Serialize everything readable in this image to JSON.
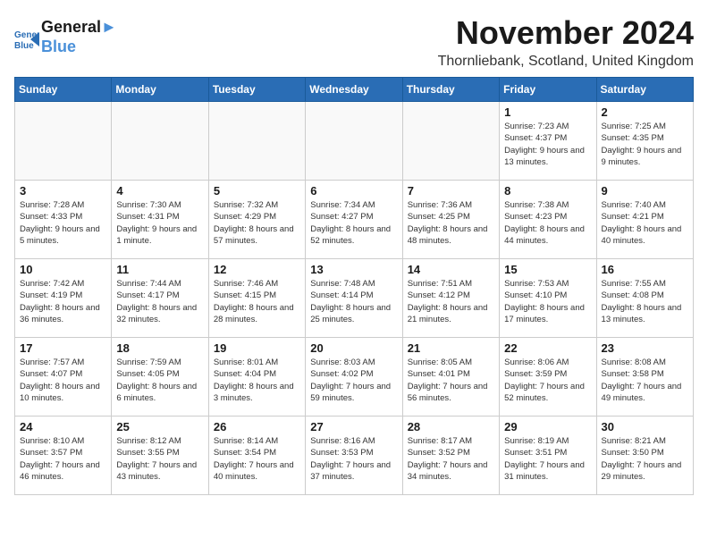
{
  "header": {
    "logo_line1": "General",
    "logo_line2": "Blue",
    "month_title": "November 2024",
    "location": "Thornliebank, Scotland, United Kingdom"
  },
  "weekdays": [
    "Sunday",
    "Monday",
    "Tuesday",
    "Wednesday",
    "Thursday",
    "Friday",
    "Saturday"
  ],
  "weeks": [
    [
      {
        "day": "",
        "sunrise": "",
        "sunset": "",
        "daylight": ""
      },
      {
        "day": "",
        "sunrise": "",
        "sunset": "",
        "daylight": ""
      },
      {
        "day": "",
        "sunrise": "",
        "sunset": "",
        "daylight": ""
      },
      {
        "day": "",
        "sunrise": "",
        "sunset": "",
        "daylight": ""
      },
      {
        "day": "",
        "sunrise": "",
        "sunset": "",
        "daylight": ""
      },
      {
        "day": "1",
        "sunrise": "Sunrise: 7:23 AM",
        "sunset": "Sunset: 4:37 PM",
        "daylight": "Daylight: 9 hours and 13 minutes."
      },
      {
        "day": "2",
        "sunrise": "Sunrise: 7:25 AM",
        "sunset": "Sunset: 4:35 PM",
        "daylight": "Daylight: 9 hours and 9 minutes."
      }
    ],
    [
      {
        "day": "3",
        "sunrise": "Sunrise: 7:28 AM",
        "sunset": "Sunset: 4:33 PM",
        "daylight": "Daylight: 9 hours and 5 minutes."
      },
      {
        "day": "4",
        "sunrise": "Sunrise: 7:30 AM",
        "sunset": "Sunset: 4:31 PM",
        "daylight": "Daylight: 9 hours and 1 minute."
      },
      {
        "day": "5",
        "sunrise": "Sunrise: 7:32 AM",
        "sunset": "Sunset: 4:29 PM",
        "daylight": "Daylight: 8 hours and 57 minutes."
      },
      {
        "day": "6",
        "sunrise": "Sunrise: 7:34 AM",
        "sunset": "Sunset: 4:27 PM",
        "daylight": "Daylight: 8 hours and 52 minutes."
      },
      {
        "day": "7",
        "sunrise": "Sunrise: 7:36 AM",
        "sunset": "Sunset: 4:25 PM",
        "daylight": "Daylight: 8 hours and 48 minutes."
      },
      {
        "day": "8",
        "sunrise": "Sunrise: 7:38 AM",
        "sunset": "Sunset: 4:23 PM",
        "daylight": "Daylight: 8 hours and 44 minutes."
      },
      {
        "day": "9",
        "sunrise": "Sunrise: 7:40 AM",
        "sunset": "Sunset: 4:21 PM",
        "daylight": "Daylight: 8 hours and 40 minutes."
      }
    ],
    [
      {
        "day": "10",
        "sunrise": "Sunrise: 7:42 AM",
        "sunset": "Sunset: 4:19 PM",
        "daylight": "Daylight: 8 hours and 36 minutes."
      },
      {
        "day": "11",
        "sunrise": "Sunrise: 7:44 AM",
        "sunset": "Sunset: 4:17 PM",
        "daylight": "Daylight: 8 hours and 32 minutes."
      },
      {
        "day": "12",
        "sunrise": "Sunrise: 7:46 AM",
        "sunset": "Sunset: 4:15 PM",
        "daylight": "Daylight: 8 hours and 28 minutes."
      },
      {
        "day": "13",
        "sunrise": "Sunrise: 7:48 AM",
        "sunset": "Sunset: 4:14 PM",
        "daylight": "Daylight: 8 hours and 25 minutes."
      },
      {
        "day": "14",
        "sunrise": "Sunrise: 7:51 AM",
        "sunset": "Sunset: 4:12 PM",
        "daylight": "Daylight: 8 hours and 21 minutes."
      },
      {
        "day": "15",
        "sunrise": "Sunrise: 7:53 AM",
        "sunset": "Sunset: 4:10 PM",
        "daylight": "Daylight: 8 hours and 17 minutes."
      },
      {
        "day": "16",
        "sunrise": "Sunrise: 7:55 AM",
        "sunset": "Sunset: 4:08 PM",
        "daylight": "Daylight: 8 hours and 13 minutes."
      }
    ],
    [
      {
        "day": "17",
        "sunrise": "Sunrise: 7:57 AM",
        "sunset": "Sunset: 4:07 PM",
        "daylight": "Daylight: 8 hours and 10 minutes."
      },
      {
        "day": "18",
        "sunrise": "Sunrise: 7:59 AM",
        "sunset": "Sunset: 4:05 PM",
        "daylight": "Daylight: 8 hours and 6 minutes."
      },
      {
        "day": "19",
        "sunrise": "Sunrise: 8:01 AM",
        "sunset": "Sunset: 4:04 PM",
        "daylight": "Daylight: 8 hours and 3 minutes."
      },
      {
        "day": "20",
        "sunrise": "Sunrise: 8:03 AM",
        "sunset": "Sunset: 4:02 PM",
        "daylight": "Daylight: 7 hours and 59 minutes."
      },
      {
        "day": "21",
        "sunrise": "Sunrise: 8:05 AM",
        "sunset": "Sunset: 4:01 PM",
        "daylight": "Daylight: 7 hours and 56 minutes."
      },
      {
        "day": "22",
        "sunrise": "Sunrise: 8:06 AM",
        "sunset": "Sunset: 3:59 PM",
        "daylight": "Daylight: 7 hours and 52 minutes."
      },
      {
        "day": "23",
        "sunrise": "Sunrise: 8:08 AM",
        "sunset": "Sunset: 3:58 PM",
        "daylight": "Daylight: 7 hours and 49 minutes."
      }
    ],
    [
      {
        "day": "24",
        "sunrise": "Sunrise: 8:10 AM",
        "sunset": "Sunset: 3:57 PM",
        "daylight": "Daylight: 7 hours and 46 minutes."
      },
      {
        "day": "25",
        "sunrise": "Sunrise: 8:12 AM",
        "sunset": "Sunset: 3:55 PM",
        "daylight": "Daylight: 7 hours and 43 minutes."
      },
      {
        "day": "26",
        "sunrise": "Sunrise: 8:14 AM",
        "sunset": "Sunset: 3:54 PM",
        "daylight": "Daylight: 7 hours and 40 minutes."
      },
      {
        "day": "27",
        "sunrise": "Sunrise: 8:16 AM",
        "sunset": "Sunset: 3:53 PM",
        "daylight": "Daylight: 7 hours and 37 minutes."
      },
      {
        "day": "28",
        "sunrise": "Sunrise: 8:17 AM",
        "sunset": "Sunset: 3:52 PM",
        "daylight": "Daylight: 7 hours and 34 minutes."
      },
      {
        "day": "29",
        "sunrise": "Sunrise: 8:19 AM",
        "sunset": "Sunset: 3:51 PM",
        "daylight": "Daylight: 7 hours and 31 minutes."
      },
      {
        "day": "30",
        "sunrise": "Sunrise: 8:21 AM",
        "sunset": "Sunset: 3:50 PM",
        "daylight": "Daylight: 7 hours and 29 minutes."
      }
    ]
  ]
}
